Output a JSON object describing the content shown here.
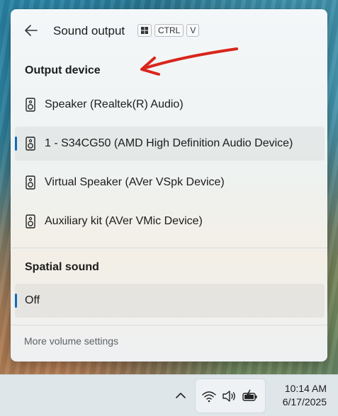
{
  "header": {
    "title": "Sound output",
    "shortcut": {
      "win_key_icon": "windows-logo-icon",
      "ctrl": "CTRL",
      "key": "V"
    },
    "back_icon": "arrow-left-icon"
  },
  "output_section": {
    "title": "Output device",
    "devices": [
      {
        "label": "Speaker (Realtek(R) Audio)",
        "selected": false,
        "icon": "speaker-icon"
      },
      {
        "label": "1 - S34CG50 (AMD High Definition Audio Device)",
        "selected": true,
        "icon": "speaker-icon"
      },
      {
        "label": "Virtual Speaker (AVer VSpk Device)",
        "selected": false,
        "icon": "speaker-icon"
      },
      {
        "label": "Auxiliary kit (AVer VMic Device)",
        "selected": false,
        "icon": "speaker-icon"
      }
    ]
  },
  "spatial_section": {
    "title": "Spatial sound",
    "option": {
      "label": "Off",
      "selected": true
    }
  },
  "footer": {
    "more_label": "More volume settings"
  },
  "taskbar": {
    "overflow_icon": "chevron-up-icon",
    "tray_icons": [
      "wifi-icon",
      "volume-icon",
      "battery-charging-icon"
    ],
    "time": "10:14 AM",
    "date": "6/17/2025"
  },
  "colors": {
    "accent": "#0f6cbd",
    "annotation": "#d9251b"
  }
}
